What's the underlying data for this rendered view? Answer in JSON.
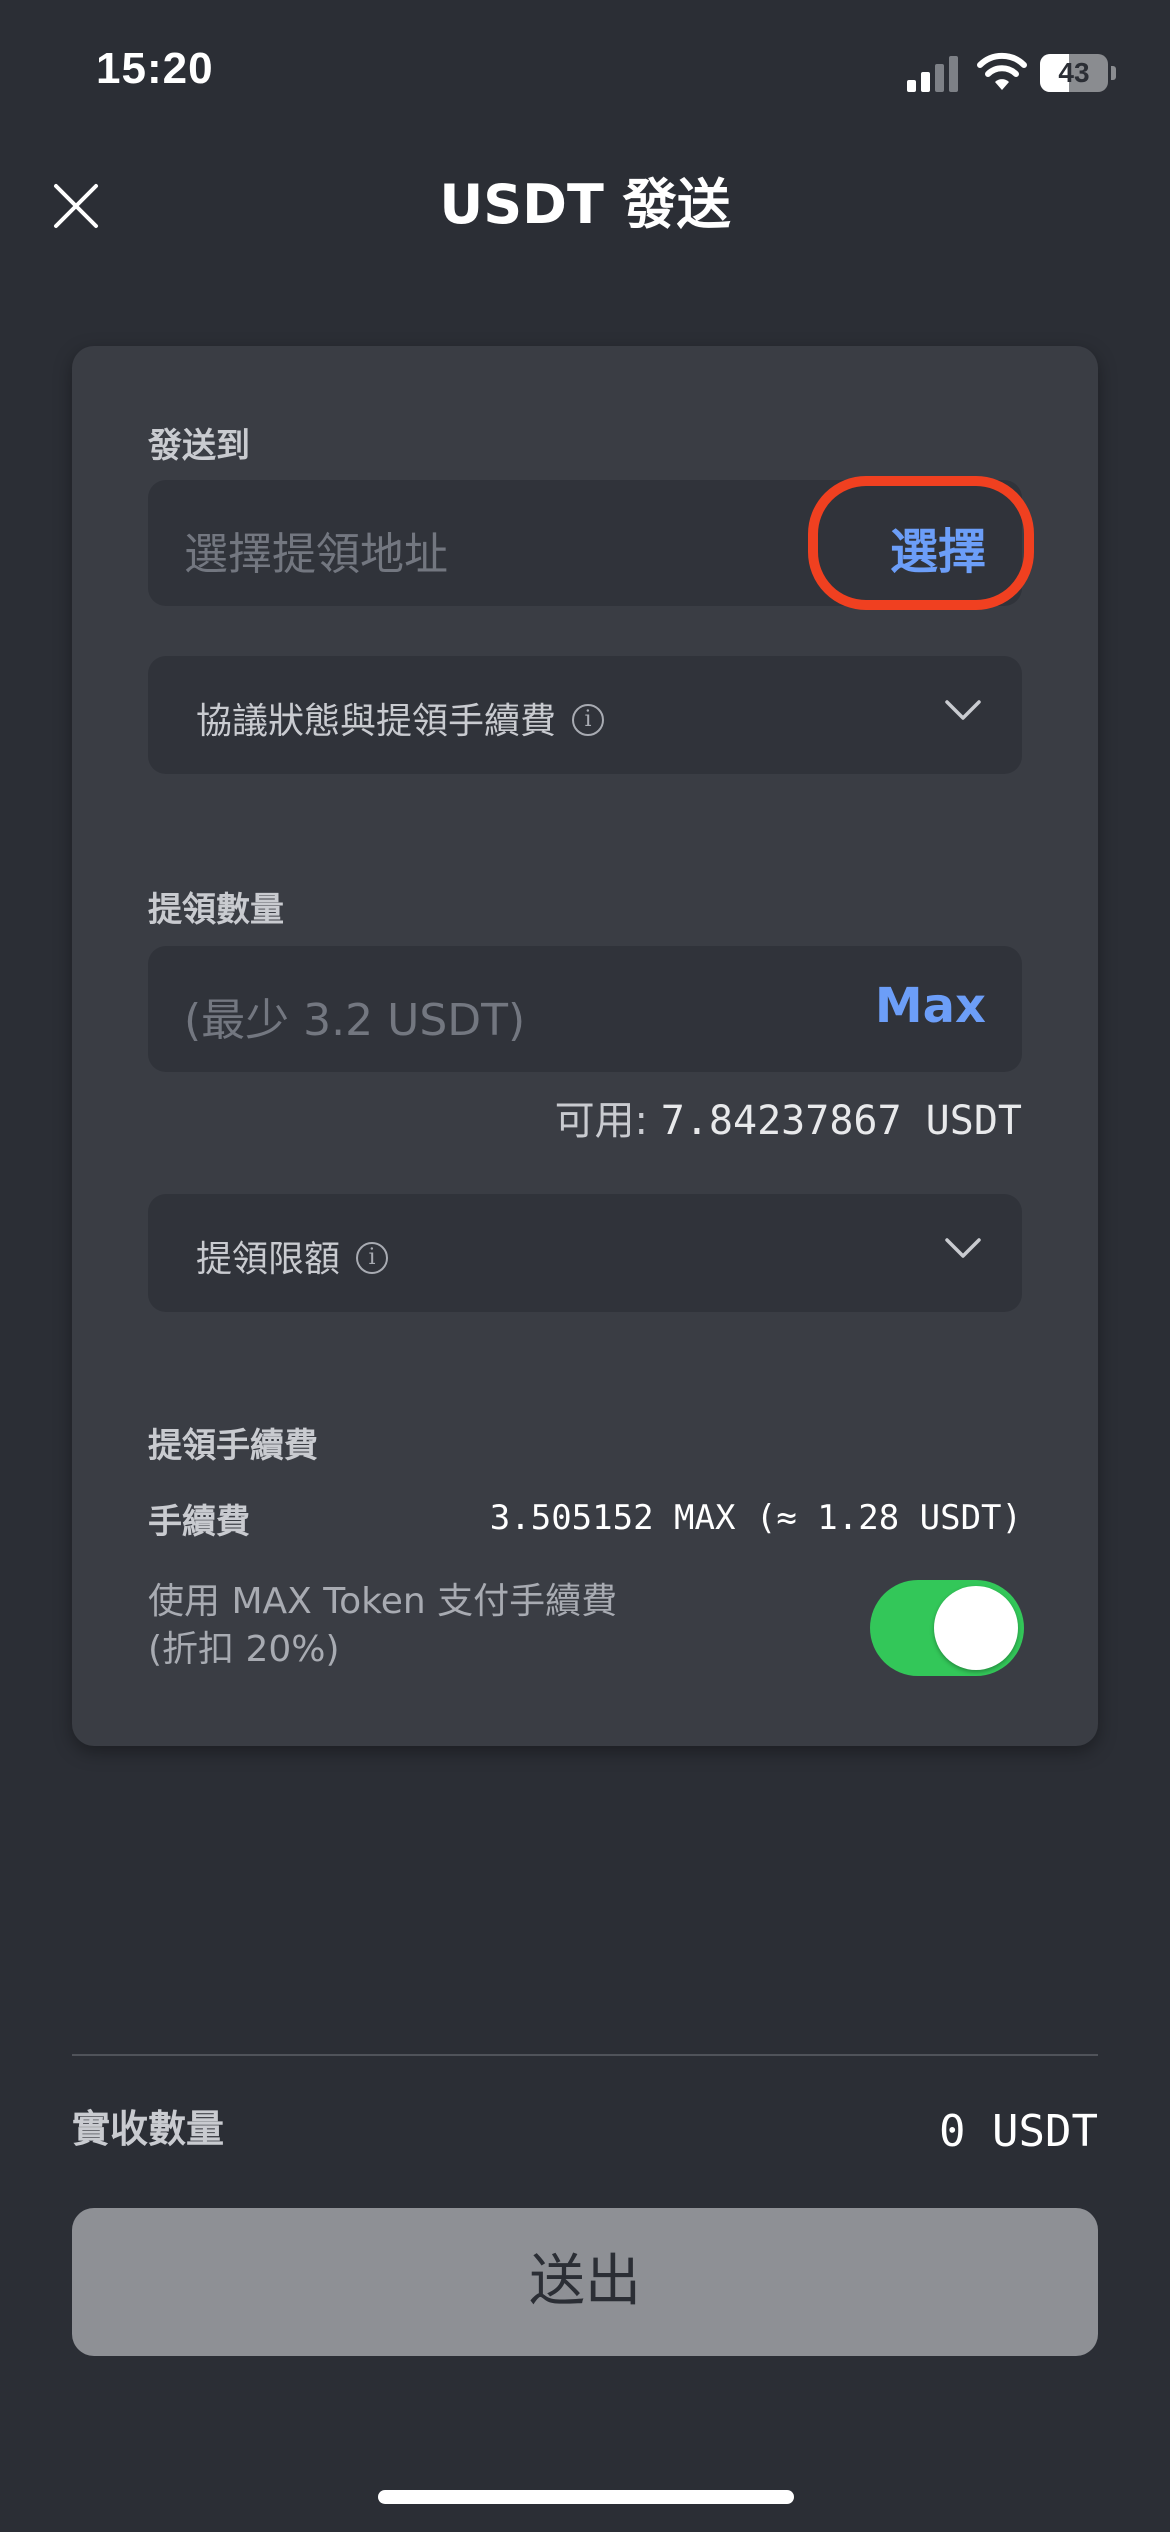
{
  "status_bar": {
    "time": "15:20",
    "battery_level": "43",
    "battery_fraction": 0.43
  },
  "header": {
    "title": "USDT 發送",
    "close_icon": "close-icon"
  },
  "send_to": {
    "label": "發送到",
    "placeholder": "選擇提領地址",
    "action_label": "選擇",
    "highlight_color": "#f04020"
  },
  "protocol": {
    "label": "協議狀態與提領手續費",
    "info_glyph": "i"
  },
  "amount": {
    "label": "提領數量",
    "placeholder": "(最少 3.2 USDT)",
    "max_label": "Max",
    "available_label": "可用:",
    "available_value": "7.84237867 USDT"
  },
  "limit": {
    "label": "提領限額",
    "info_glyph": "i"
  },
  "fee": {
    "section_label": "提領手續費",
    "fee_label": "手續費",
    "fee_value": "3.505152 MAX (≈ 1.28 USDT)",
    "toggle_text_line1": "使用 MAX Token 支付手續費",
    "toggle_text_line2": "(折扣 20%)",
    "toggle_on": true,
    "toggle_color": "#33c759"
  },
  "footer": {
    "receive_label": "實收數量",
    "receive_value": "0 USDT",
    "submit_label": "送出"
  },
  "colors": {
    "background": "#2b2e35",
    "card": "#3a3d44",
    "accent": "#6c9ef8"
  }
}
